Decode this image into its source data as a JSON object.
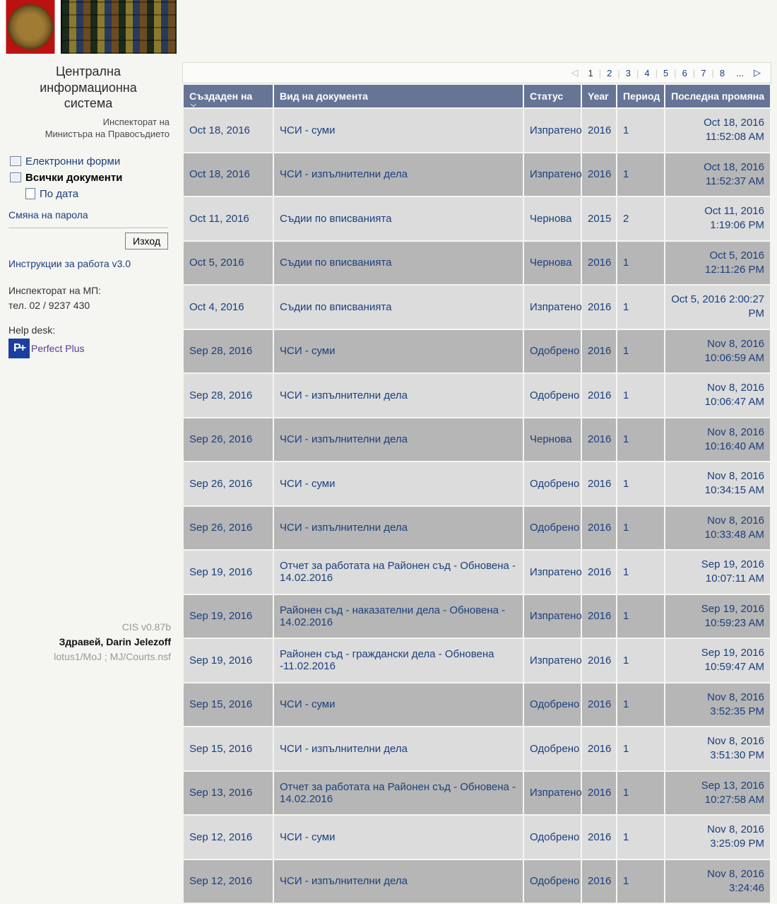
{
  "app": {
    "title_line1": "Централна",
    "title_line2": "информационна",
    "title_line3": "система",
    "subtitle_line1": "Инспекторат на",
    "subtitle_line2": "Министъра на Правосъдието"
  },
  "nav": {
    "forms": "Електронни форми",
    "all_docs": "Всички документи",
    "by_date": "По дата"
  },
  "sidebar": {
    "change_password": "Смяна на парола",
    "logout": "Изход",
    "instructions": "Инструкции за работа v3.0",
    "inspectorate_label": "Инспекторат на МП:",
    "inspectorate_phone": "тел. 02 / 9237 430",
    "help_desk_label": "Help desk:",
    "perfect_plus": "Perfect Plus"
  },
  "footer": {
    "version": "CIS v0.87b",
    "greeting": "Здравей, Darin Jelezoff",
    "path": "lotus1/MoJ ; MJ/Courts.nsf"
  },
  "pager": {
    "current": "1",
    "pages": [
      "2",
      "3",
      "4",
      "5",
      "6",
      "7",
      "8"
    ],
    "ellipsis": "..."
  },
  "columns": {
    "created": "Създаден на",
    "type": "Вид на документа",
    "status": "Статус",
    "year": "Year",
    "period": "Период",
    "changed": "Последна промяна"
  },
  "rows": [
    {
      "created": "Oct 18, 2016",
      "type": "ЧСИ - суми",
      "status": "Изпратено",
      "year": "2016",
      "period": "1",
      "changed": "Oct 18, 2016 11:52:08 AM"
    },
    {
      "created": "Oct 18, 2016",
      "type": "ЧСИ - изпълнителни дела",
      "status": "Изпратено",
      "year": "2016",
      "period": "1",
      "changed": "Oct 18, 2016 11:52:37 AM"
    },
    {
      "created": "Oct 11, 2016",
      "type": "Съдии по вписванията",
      "status": "Чернова",
      "year": "2015",
      "period": "2",
      "changed": "Oct 11, 2016 1:19:06 PM"
    },
    {
      "created": "Oct 5, 2016",
      "type": "Съдии по вписванията",
      "status": "Чернова",
      "year": "2016",
      "period": "1",
      "changed": "Oct 5, 2016 12:11:26 PM"
    },
    {
      "created": "Oct 4, 2016",
      "type": "Съдии по вписванията",
      "status": "Изпратено",
      "year": "2016",
      "period": "1",
      "changed": "Oct 5, 2016 2:00:27 PM"
    },
    {
      "created": "Sep 28, 2016",
      "type": "ЧСИ - суми",
      "status": "Одобрено",
      "year": "2016",
      "period": "1",
      "changed": "Nov 8, 2016 10:06:59 AM"
    },
    {
      "created": "Sep 28, 2016",
      "type": "ЧСИ - изпълнителни дела",
      "status": "Одобрено",
      "year": "2016",
      "period": "1",
      "changed": "Nov 8, 2016 10:06:47 AM"
    },
    {
      "created": "Sep 26, 2016",
      "type": "ЧСИ - изпълнителни дела",
      "status": "Чернова",
      "year": "2016",
      "period": "1",
      "changed": "Nov 8, 2016 10:16:40 AM"
    },
    {
      "created": "Sep 26, 2016",
      "type": "ЧСИ - суми",
      "status": "Одобрено",
      "year": "2016",
      "period": "1",
      "changed": "Nov 8, 2016 10:34:15 AM"
    },
    {
      "created": "Sep 26, 2016",
      "type": "ЧСИ - изпълнителни дела",
      "status": "Одобрено",
      "year": "2016",
      "period": "1",
      "changed": "Nov 8, 2016 10:33:48 AM"
    },
    {
      "created": "Sep 19, 2016",
      "type": "Отчет за работата на Районен съд - Обновена - 14.02.2016",
      "status": "Изпратено",
      "year": "2016",
      "period": "1",
      "changed": "Sep 19, 2016 10:07:11 AM"
    },
    {
      "created": "Sep 19, 2016",
      "type": "Районен съд - наказателни дела - Обновена - 14.02.2016",
      "status": "Изпратено",
      "year": "2016",
      "period": "1",
      "changed": "Sep 19, 2016 10:59:23 AM"
    },
    {
      "created": "Sep 19, 2016",
      "type": "Районен съд - граждански дела - Обновена -11.02.2016",
      "status": "Изпратено",
      "year": "2016",
      "period": "1",
      "changed": "Sep 19, 2016 10:59:47 AM"
    },
    {
      "created": "Sep 15, 2016",
      "type": "ЧСИ - суми",
      "status": "Одобрено",
      "year": "2016",
      "period": "1",
      "changed": "Nov 8, 2016 3:52:35 PM"
    },
    {
      "created": "Sep 15, 2016",
      "type": "ЧСИ - изпълнителни дела",
      "status": "Одобрено",
      "year": "2016",
      "period": "1",
      "changed": "Nov 8, 2016 3:51:30 PM"
    },
    {
      "created": "Sep 13, 2016",
      "type": "Отчет за работата на Районен съд - Обновена - 14.02.2016",
      "status": "Изпратено",
      "year": "2016",
      "period": "1",
      "changed": "Sep 13, 2016 10:27:58 AM"
    },
    {
      "created": "Sep 12, 2016",
      "type": "ЧСИ - суми",
      "status": "Одобрено",
      "year": "2016",
      "period": "1",
      "changed": "Nov 8, 2016 3:25:09 PM"
    },
    {
      "created": "Sep 12, 2016",
      "type": "ЧСИ - изпълнителни дела",
      "status": "Одобрено",
      "year": "2016",
      "period": "1",
      "changed": "Nov 8, 2016 3:24:46"
    }
  ]
}
